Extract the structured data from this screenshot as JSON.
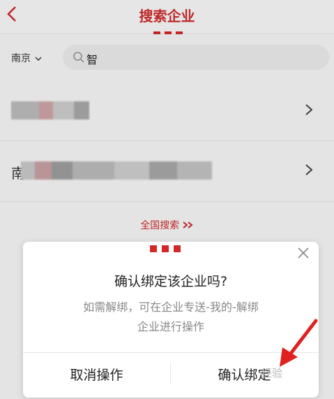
{
  "header": {
    "title": "搜索企业"
  },
  "search": {
    "city": "南京",
    "query": "智"
  },
  "results": [
    {
      "name_prefix": ""
    },
    {
      "name_prefix": "南"
    }
  ],
  "more_link": "全国搜索 ",
  "dialog": {
    "title": "确认绑定该企业吗?",
    "line1": "如需解绑，可在企业专送-我的-解绑",
    "line2": "企业进行操作",
    "cancel": "取消操作",
    "confirm": "确认绑定"
  },
  "watermark": "经验",
  "colors": {
    "accent": "#cf2b2b"
  }
}
